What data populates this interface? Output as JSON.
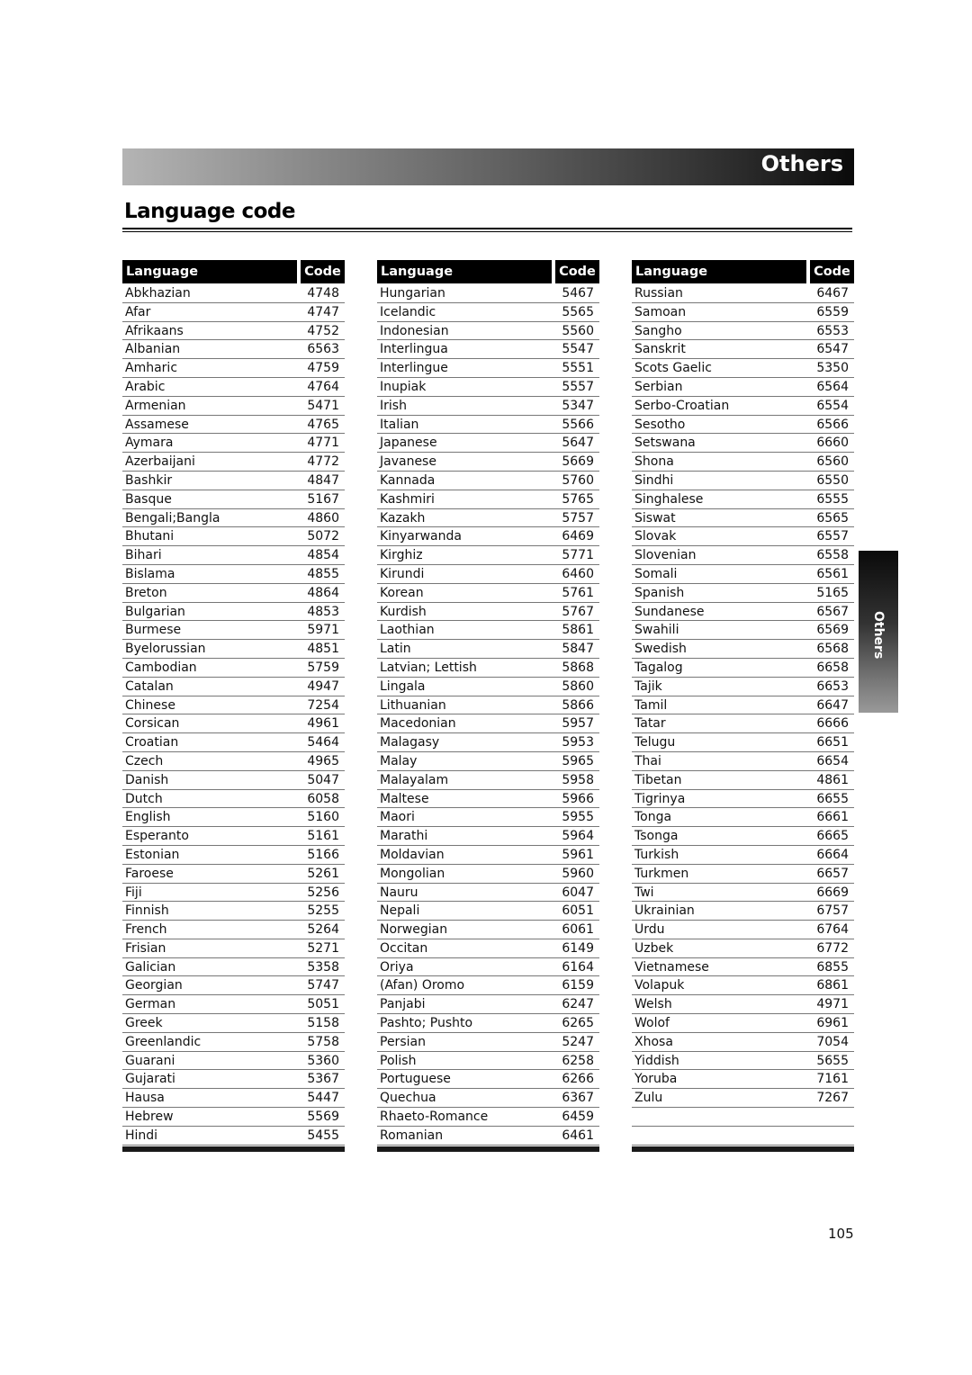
{
  "header": {
    "section_title": "Others"
  },
  "page": {
    "title": "Language code",
    "side_tab": "Others",
    "page_number": "105"
  },
  "table_headers": {
    "language": "Language",
    "code": "Code"
  },
  "columns": [
    {
      "rows": [
        {
          "language": "Abkhazian",
          "code": "4748"
        },
        {
          "language": "Afar",
          "code": "4747"
        },
        {
          "language": "Afrikaans",
          "code": "4752"
        },
        {
          "language": "Albanian",
          "code": "6563"
        },
        {
          "language": "Amharic",
          "code": "4759"
        },
        {
          "language": "Arabic",
          "code": "4764"
        },
        {
          "language": "Armenian",
          "code": "5471"
        },
        {
          "language": "Assamese",
          "code": "4765"
        },
        {
          "language": "Aymara",
          "code": "4771"
        },
        {
          "language": "Azerbaijani",
          "code": "4772"
        },
        {
          "language": "Bashkir",
          "code": "4847"
        },
        {
          "language": "Basque",
          "code": "5167"
        },
        {
          "language": "Bengali;Bangla",
          "code": "4860"
        },
        {
          "language": "Bhutani",
          "code": "5072"
        },
        {
          "language": "Bihari",
          "code": "4854"
        },
        {
          "language": "Bislama",
          "code": "4855"
        },
        {
          "language": "Breton",
          "code": "4864"
        },
        {
          "language": "Bulgarian",
          "code": "4853"
        },
        {
          "language": "Burmese",
          "code": "5971"
        },
        {
          "language": "Byelorussian",
          "code": "4851"
        },
        {
          "language": "Cambodian",
          "code": "5759"
        },
        {
          "language": "Catalan",
          "code": "4947"
        },
        {
          "language": "Chinese",
          "code": "7254"
        },
        {
          "language": "Corsican",
          "code": "4961"
        },
        {
          "language": "Croatian",
          "code": "5464"
        },
        {
          "language": "Czech",
          "code": "4965"
        },
        {
          "language": "Danish",
          "code": "5047"
        },
        {
          "language": "Dutch",
          "code": "6058"
        },
        {
          "language": "English",
          "code": "5160"
        },
        {
          "language": "Esperanto",
          "code": "5161"
        },
        {
          "language": "Estonian",
          "code": "5166"
        },
        {
          "language": "Faroese",
          "code": "5261"
        },
        {
          "language": "Fiji",
          "code": "5256"
        },
        {
          "language": "Finnish",
          "code": "5255"
        },
        {
          "language": "French",
          "code": "5264"
        },
        {
          "language": "Frisian",
          "code": "5271"
        },
        {
          "language": "Galician",
          "code": "5358"
        },
        {
          "language": "Georgian",
          "code": "5747"
        },
        {
          "language": "German",
          "code": "5051"
        },
        {
          "language": "Greek",
          "code": "5158"
        },
        {
          "language": "Greenlandic",
          "code": "5758"
        },
        {
          "language": "Guarani",
          "code": "5360"
        },
        {
          "language": "Gujarati",
          "code": "5367"
        },
        {
          "language": "Hausa",
          "code": "5447"
        },
        {
          "language": "Hebrew",
          "code": "5569"
        },
        {
          "language": "Hindi",
          "code": "5455"
        }
      ]
    },
    {
      "rows": [
        {
          "language": "Hungarian",
          "code": "5467"
        },
        {
          "language": "Icelandic",
          "code": "5565"
        },
        {
          "language": "Indonesian",
          "code": "5560"
        },
        {
          "language": "Interlingua",
          "code": "5547"
        },
        {
          "language": "Interlingue",
          "code": "5551"
        },
        {
          "language": "Inupiak",
          "code": "5557"
        },
        {
          "language": "Irish",
          "code": "5347"
        },
        {
          "language": "Italian",
          "code": "5566"
        },
        {
          "language": "Japanese",
          "code": "5647"
        },
        {
          "language": "Javanese",
          "code": "5669"
        },
        {
          "language": "Kannada",
          "code": "5760"
        },
        {
          "language": "Kashmiri",
          "code": "5765"
        },
        {
          "language": "Kazakh",
          "code": "5757"
        },
        {
          "language": "Kinyarwanda",
          "code": "6469"
        },
        {
          "language": "Kirghiz",
          "code": "5771"
        },
        {
          "language": "Kirundi",
          "code": "6460"
        },
        {
          "language": "Korean",
          "code": "5761"
        },
        {
          "language": "Kurdish",
          "code": "5767"
        },
        {
          "language": "Laothian",
          "code": "5861"
        },
        {
          "language": "Latin",
          "code": "5847"
        },
        {
          "language": "Latvian; Lettish",
          "code": "5868"
        },
        {
          "language": "Lingala",
          "code": "5860"
        },
        {
          "language": "Lithuanian",
          "code": "5866"
        },
        {
          "language": "Macedonian",
          "code": "5957"
        },
        {
          "language": "Malagasy",
          "code": "5953"
        },
        {
          "language": "Malay",
          "code": "5965"
        },
        {
          "language": "Malayalam",
          "code": "5958"
        },
        {
          "language": "Maltese",
          "code": "5966"
        },
        {
          "language": "Maori",
          "code": "5955"
        },
        {
          "language": "Marathi",
          "code": "5964"
        },
        {
          "language": "Moldavian",
          "code": "5961"
        },
        {
          "language": "Mongolian",
          "code": "5960"
        },
        {
          "language": "Nauru",
          "code": "6047"
        },
        {
          "language": "Nepali",
          "code": "6051"
        },
        {
          "language": "Norwegian",
          "code": "6061"
        },
        {
          "language": "Occitan",
          "code": "6149"
        },
        {
          "language": "Oriya",
          "code": "6164"
        },
        {
          "language": "(Afan) Oromo",
          "code": "6159"
        },
        {
          "language": "Panjabi",
          "code": "6247"
        },
        {
          "language": "Pashto; Pushto",
          "code": "6265"
        },
        {
          "language": "Persian",
          "code": "5247"
        },
        {
          "language": "Polish",
          "code": "6258"
        },
        {
          "language": "Portuguese",
          "code": "6266"
        },
        {
          "language": "Quechua",
          "code": "6367"
        },
        {
          "language": "Rhaeto-Romance",
          "code": "6459"
        },
        {
          "language": "Romanian",
          "code": "6461"
        }
      ]
    },
    {
      "rows": [
        {
          "language": "Russian",
          "code": "6467"
        },
        {
          "language": "Samoan",
          "code": "6559"
        },
        {
          "language": "Sangho",
          "code": "6553"
        },
        {
          "language": "Sanskrit",
          "code": "6547"
        },
        {
          "language": "Scots Gaelic",
          "code": "5350"
        },
        {
          "language": "Serbian",
          "code": "6564"
        },
        {
          "language": "Serbo-Croatian",
          "code": "6554"
        },
        {
          "language": "Sesotho",
          "code": "6566"
        },
        {
          "language": "Setswana",
          "code": "6660"
        },
        {
          "language": "Shona",
          "code": "6560"
        },
        {
          "language": "Sindhi",
          "code": "6550"
        },
        {
          "language": "Singhalese",
          "code": "6555"
        },
        {
          "language": "Siswat",
          "code": "6565"
        },
        {
          "language": "Slovak",
          "code": "6557"
        },
        {
          "language": "Slovenian",
          "code": "6558"
        },
        {
          "language": "Somali",
          "code": "6561"
        },
        {
          "language": "Spanish",
          "code": "5165"
        },
        {
          "language": "Sundanese",
          "code": "6567"
        },
        {
          "language": "Swahili",
          "code": "6569"
        },
        {
          "language": "Swedish",
          "code": "6568"
        },
        {
          "language": "Tagalog",
          "code": "6658"
        },
        {
          "language": "Tajik",
          "code": "6653"
        },
        {
          "language": "Tamil",
          "code": "6647"
        },
        {
          "language": "Tatar",
          "code": "6666"
        },
        {
          "language": "Telugu",
          "code": "6651"
        },
        {
          "language": "Thai",
          "code": "6654"
        },
        {
          "language": "Tibetan",
          "code": "4861"
        },
        {
          "language": "Tigrinya",
          "code": "6655"
        },
        {
          "language": "Tonga",
          "code": "6661"
        },
        {
          "language": "Tsonga",
          "code": "6665"
        },
        {
          "language": "Turkish",
          "code": "6664"
        },
        {
          "language": "Turkmen",
          "code": "6657"
        },
        {
          "language": "Twi",
          "code": "6669"
        },
        {
          "language": "Ukrainian",
          "code": "6757"
        },
        {
          "language": "Urdu",
          "code": "6764"
        },
        {
          "language": "Uzbek",
          "code": "6772"
        },
        {
          "language": "Vietnamese",
          "code": "6855"
        },
        {
          "language": "Volapuk",
          "code": "6861"
        },
        {
          "language": "Welsh",
          "code": "4971"
        },
        {
          "language": "Wolof",
          "code": "6961"
        },
        {
          "language": "Xhosa",
          "code": "7054"
        },
        {
          "language": "Yiddish",
          "code": "5655"
        },
        {
          "language": "Yoruba",
          "code": "7161"
        },
        {
          "language": "Zulu",
          "code": "7267"
        }
      ]
    }
  ]
}
